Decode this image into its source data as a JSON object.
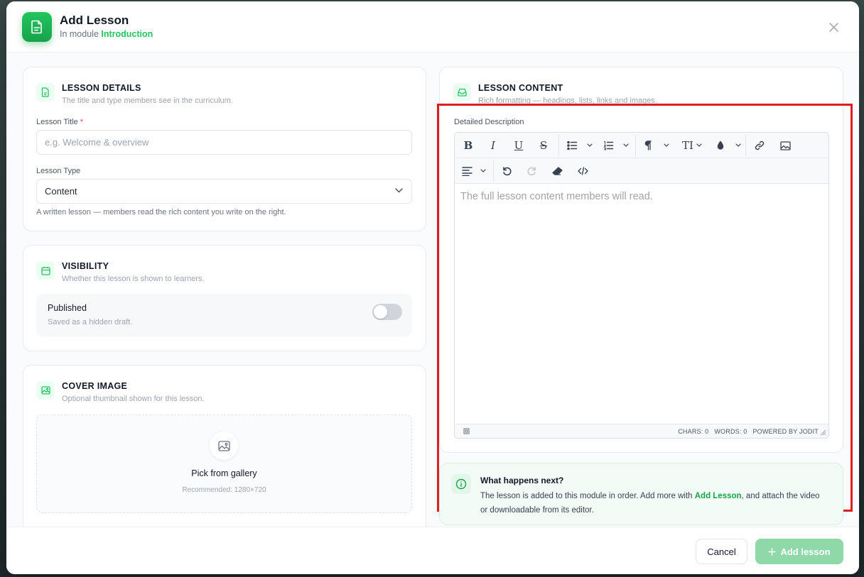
{
  "header": {
    "title": "Add Lesson",
    "subtitle_prefix": "In module",
    "module_name": "Introduction"
  },
  "lesson_details": {
    "title": "LESSON DETAILS",
    "subtitle": "The title and type members see in the curriculum.",
    "title_label": "Lesson Title",
    "required_mark": "*",
    "title_value": "",
    "title_placeholder": "e.g. Welcome & overview",
    "type_label": "Lesson Type",
    "type_value": "Content",
    "type_hint": "A written lesson — members read the rich content you write on the right."
  },
  "visibility": {
    "title": "VISIBILITY",
    "subtitle": "Whether this lesson is shown to learners.",
    "toggle_label": "Published",
    "toggle_sub": "Saved as a hidden draft.",
    "published": false
  },
  "cover_image": {
    "title": "COVER IMAGE",
    "subtitle": "Optional thumbnail shown for this lesson.",
    "pick_label": "Pick from gallery",
    "recommended": "Recommended: 1280×720"
  },
  "lesson_content": {
    "title": "LESSON CONTENT",
    "subtitle": "Rich formatting — headings, lists, links and images.",
    "field_label": "Detailed Description",
    "placeholder": "The full lesson content members will read.",
    "toolbar": {
      "bold": "B",
      "italic": "I",
      "underline": "U",
      "strike": "S",
      "font_size": "TI"
    },
    "status": {
      "chars": "CHARS: 0",
      "words": "WORDS: 0",
      "powered": "POWERED BY JODIT"
    }
  },
  "info": {
    "title": "What happens next?",
    "text_before": "The lesson is added to this module in order. Add more with ",
    "link": "Add Lesson",
    "text_after": ", and attach the video or downloadable from its editor."
  },
  "footer": {
    "cancel": "Cancel",
    "add": "Add lesson"
  },
  "colors": {
    "accent": "#22c55e",
    "highlight": "#e11d24"
  }
}
